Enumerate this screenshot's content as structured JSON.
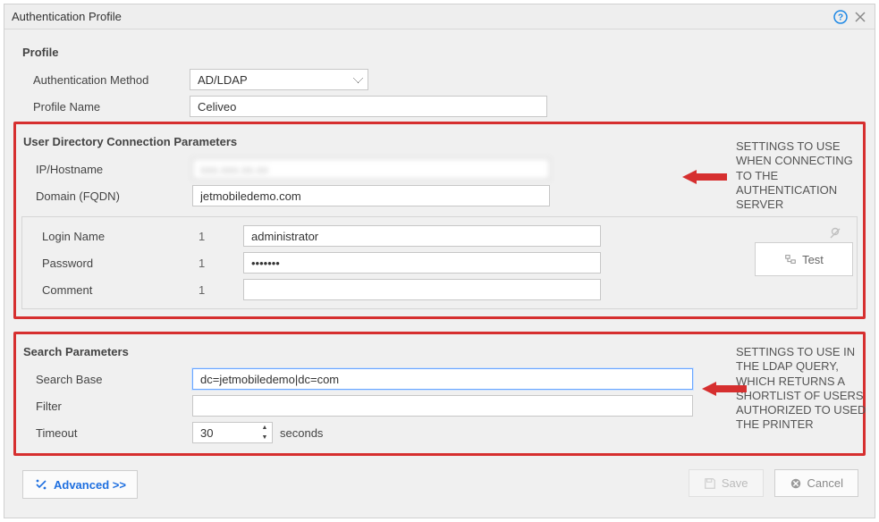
{
  "titlebar": {
    "title": "Authentication Profile"
  },
  "profile": {
    "heading": "Profile",
    "auth_method_label": "Authentication Method",
    "auth_method_value": "AD/LDAP",
    "profile_name_label": "Profile Name",
    "profile_name_value": "Celiveo"
  },
  "udcp": {
    "heading": "User Directory Connection Parameters",
    "ip_label": "IP/Hostname",
    "ip_value": "xxx.xxx.xx.xx",
    "domain_label": "Domain (FQDN)",
    "domain_value": "jetmobiledemo.com",
    "login_label": "Login Name",
    "login_num": "1",
    "login_value": "administrator",
    "password_label": "Password",
    "password_num": "1",
    "password_value": "•••••••",
    "comment_label": "Comment",
    "comment_num": "1",
    "comment_value": ""
  },
  "test": {
    "label": "Test"
  },
  "search": {
    "heading": "Search Parameters",
    "base_label": "Search Base",
    "base_value": "dc=jetmobiledemo|dc=com",
    "filter_label": "Filter",
    "filter_value": "",
    "timeout_label": "Timeout",
    "timeout_value": "30",
    "timeout_unit": "seconds"
  },
  "callouts": {
    "conn": "SETTINGS TO USE WHEN CONNECTING TO THE AUTHENTICATION SERVER",
    "search": "SETTINGS TO USE IN THE LDAP QUERY, WHICH RETURNS A SHORTLIST OF USERS AUTHORIZED TO USED THE PRINTER"
  },
  "advanced": {
    "label": "Advanced >>"
  },
  "footer": {
    "save": "Save",
    "cancel": "Cancel"
  }
}
